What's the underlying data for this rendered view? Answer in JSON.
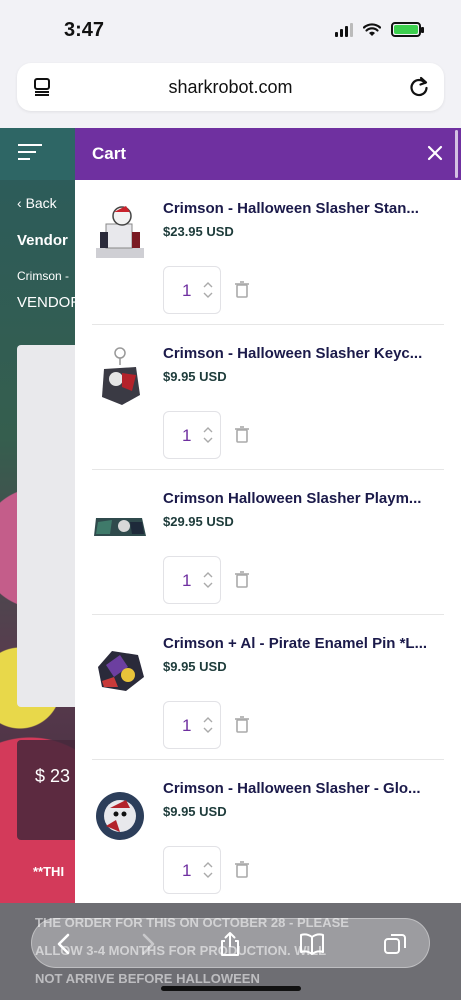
{
  "status_bar": {
    "time": "3:47"
  },
  "browser": {
    "url": "sharkrobot.com",
    "icons": [
      "reader-icon",
      "reload-icon"
    ]
  },
  "background_page": {
    "back_label": "Back",
    "vendor_label": "Vendor",
    "breadcrumb": "Crimson -",
    "vendor_caps": "VENDOR",
    "price_partial": "$ 23",
    "note_partial": "**THI",
    "footer_line1": "THE ORDER FOR THIS ON OCTOBER 28 - PLEASE",
    "footer_line2": "ALLOW 3-4 MONTHS FOR PRODUCTION. WILL",
    "footer_line3": "NOT ARRIVE BEFORE HALLOWEEN"
  },
  "cart": {
    "title": "Cart",
    "accent_color": "#6f30a0",
    "items": [
      {
        "title": "Crimson - Halloween Slasher Stan...",
        "price": "$23.95 USD",
        "quantity": "1"
      },
      {
        "title": "Crimson - Halloween Slasher Keyc...",
        "price": "$9.95 USD",
        "quantity": "1"
      },
      {
        "title": "Crimson Halloween Slasher Playm...",
        "price": "$29.95 USD",
        "quantity": "1"
      },
      {
        "title": "Crimson + Al - Pirate Enamel Pin *L...",
        "price": "$9.95 USD",
        "quantity": "1"
      },
      {
        "title": "Crimson - Halloween Slasher - Glo...",
        "price": "$9.95 USD",
        "quantity": "1"
      }
    ]
  },
  "toolbar": {
    "icons": [
      "back-icon",
      "forward-icon",
      "share-icon",
      "bookmarks-icon",
      "tabs-icon"
    ]
  }
}
